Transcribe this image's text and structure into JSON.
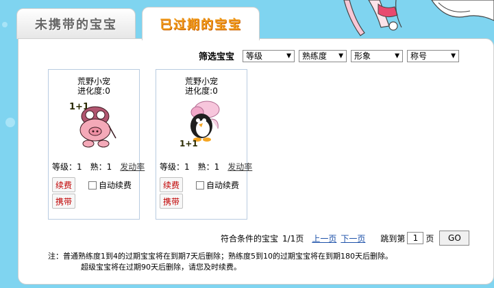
{
  "tabs": [
    {
      "label": "未携带的宝宝"
    },
    {
      "label": "已过期的宝宝"
    }
  ],
  "filter": {
    "label": "筛选宝宝",
    "selects": [
      "等级",
      "熟练度",
      "形象",
      "称号"
    ]
  },
  "pets": [
    {
      "name": "荒野小宠",
      "evolution": "进化度:0",
      "level": "等级：1",
      "proficiency": "熟：1",
      "action_link": "发动率",
      "renew": "续费",
      "carry": "携带",
      "auto_renew": "自动续费",
      "badge": "1+1"
    },
    {
      "name": "荒野小宠",
      "evolution": "进化度:0",
      "level": "等级：1",
      "proficiency": "熟：1",
      "action_link": "发动率",
      "renew": "续费",
      "carry": "携带",
      "auto_renew": "自动续费",
      "badge": "1+1"
    }
  ],
  "pager": {
    "summary": "符合条件的宝宝",
    "pages": "1/1页",
    "prev": "上一页",
    "next": "下一页",
    "jump_prefix": "跳到第",
    "jump_value": "1",
    "jump_suffix": "页",
    "go": "GO"
  },
  "notes": {
    "line1": "注：普通熟练度1到4的过期宝宝将在到期7天后删除；熟练度5到10的过期宝宝将在到期180天后删除。",
    "line2": "超级宝宝将在过期90天后删除，请您及时续费。"
  }
}
